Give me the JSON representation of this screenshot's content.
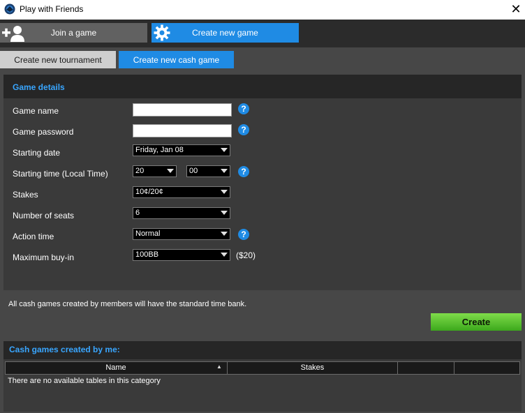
{
  "window": {
    "title": "Play with Friends",
    "close_glyph": "✕"
  },
  "topnav": {
    "join_label": "Join a game",
    "create_label": "Create new game"
  },
  "tabs": {
    "tournament": "Create new tournament",
    "cash": "Create new cash game"
  },
  "details": {
    "title": "Game details",
    "labels": {
      "game_name": "Game name",
      "game_password": "Game password",
      "starting_date": "Starting date",
      "starting_time": "Starting time (Local Time)",
      "stakes": "Stakes",
      "seats": "Number of seats",
      "action_time": "Action time",
      "max_buyin": "Maximum buy-in"
    },
    "values": {
      "game_name": "",
      "game_password": "",
      "starting_date": "Friday, Jan 08",
      "hour": "20",
      "minute": "00",
      "stakes": "10¢/20¢",
      "seats": "6",
      "action_time": "Normal",
      "max_buyin": "100BB"
    },
    "buyin_note": "($20)",
    "help_glyph": "?"
  },
  "info_note": "All cash games created by members will have the standard time bank.",
  "create_button": "Create",
  "list": {
    "title": "Cash games created by me:",
    "columns": [
      "Name",
      "Stakes"
    ],
    "sort_glyph": "▲",
    "empty_message": "There are no available tables in this category"
  }
}
